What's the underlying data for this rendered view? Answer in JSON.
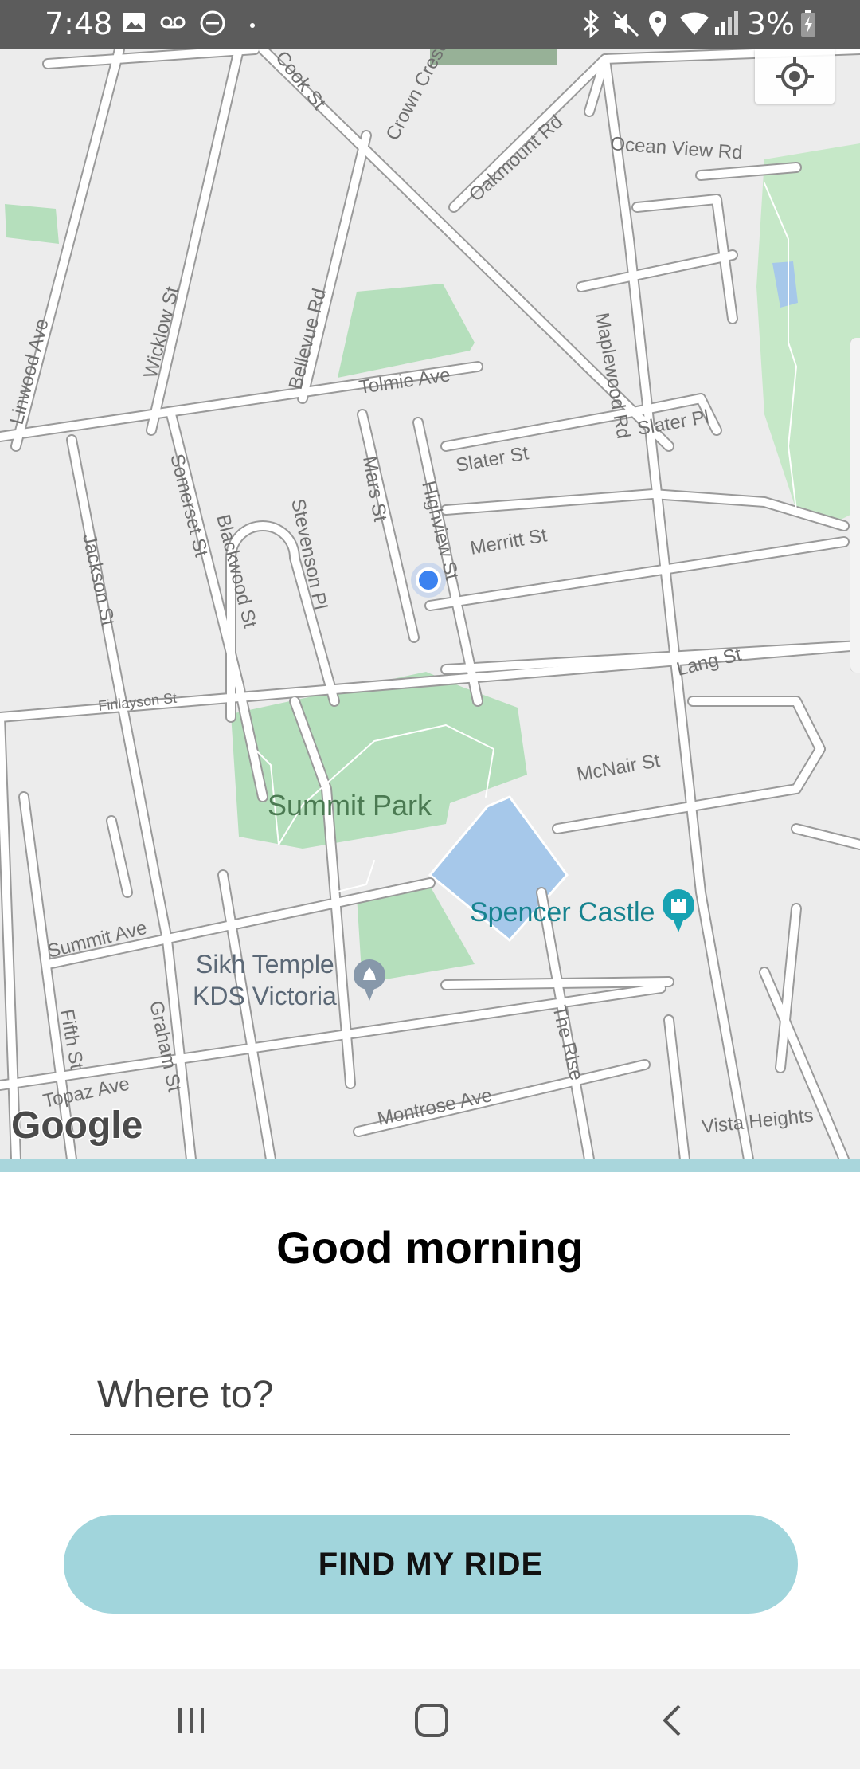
{
  "status_bar": {
    "time": "7:48",
    "battery_text": "3%",
    "icons": [
      "image-icon",
      "voicemail-icon",
      "do-not-disturb-icon",
      "dot-icon",
      "bluetooth-icon",
      "mute-icon",
      "location-icon",
      "wifi-icon",
      "signal-icon",
      "battery-charging-icon"
    ]
  },
  "map": {
    "streets": {
      "cook": "Cook St",
      "crown": "Crown Crescent",
      "oakmount": "Oakmount Rd",
      "ocean_view": "Ocean View Rd",
      "linwood": "Linwood Ave",
      "wicklow": "Wicklow St",
      "bellevue": "Bellevue Rd",
      "tolmie": "Tolmie Ave",
      "maplewood": "Maplewood Rd",
      "slater_pl": "Slater Pl",
      "slater_st": "Slater St",
      "mars": "Mars St",
      "highview": "Highview St",
      "merritt": "Merritt St",
      "somerset": "Somerset St",
      "blackwood": "Blackwood St",
      "stevenson": "Stevenson Pl",
      "jackson": "Jackson St",
      "finlayson": "Finlayson St",
      "lang": "Lang St",
      "mcnair": "McNair St",
      "summit_ave": "Summit Ave",
      "fifth": "Fifth St",
      "graham": "Graham St",
      "topaz": "Topaz Ave",
      "the_rise": "The Rise",
      "montrose": "Montrose Ave",
      "vista_heights": "Vista Heights"
    },
    "park_name": "Summit Park",
    "poi_temple_line1": "Sikh Temple",
    "poi_temple_line2": "KDS Victoria",
    "poi_castle": "Spencer Castle",
    "attribution": "Google",
    "colors": {
      "background": "#ececec",
      "road": "#ffffff",
      "road_outline": "#9a9a9a",
      "park": "#b5dfbc",
      "water": "#a6c8ea",
      "user_location": "#3b82f0"
    }
  },
  "sheet": {
    "greeting": "Good morning",
    "destination_placeholder": "Where to?",
    "find_button_label": "FIND MY RIDE",
    "accent_color": "#a1d5dc"
  },
  "nav_bar": {
    "icons": [
      "recent-apps-icon",
      "home-icon",
      "back-icon"
    ]
  }
}
